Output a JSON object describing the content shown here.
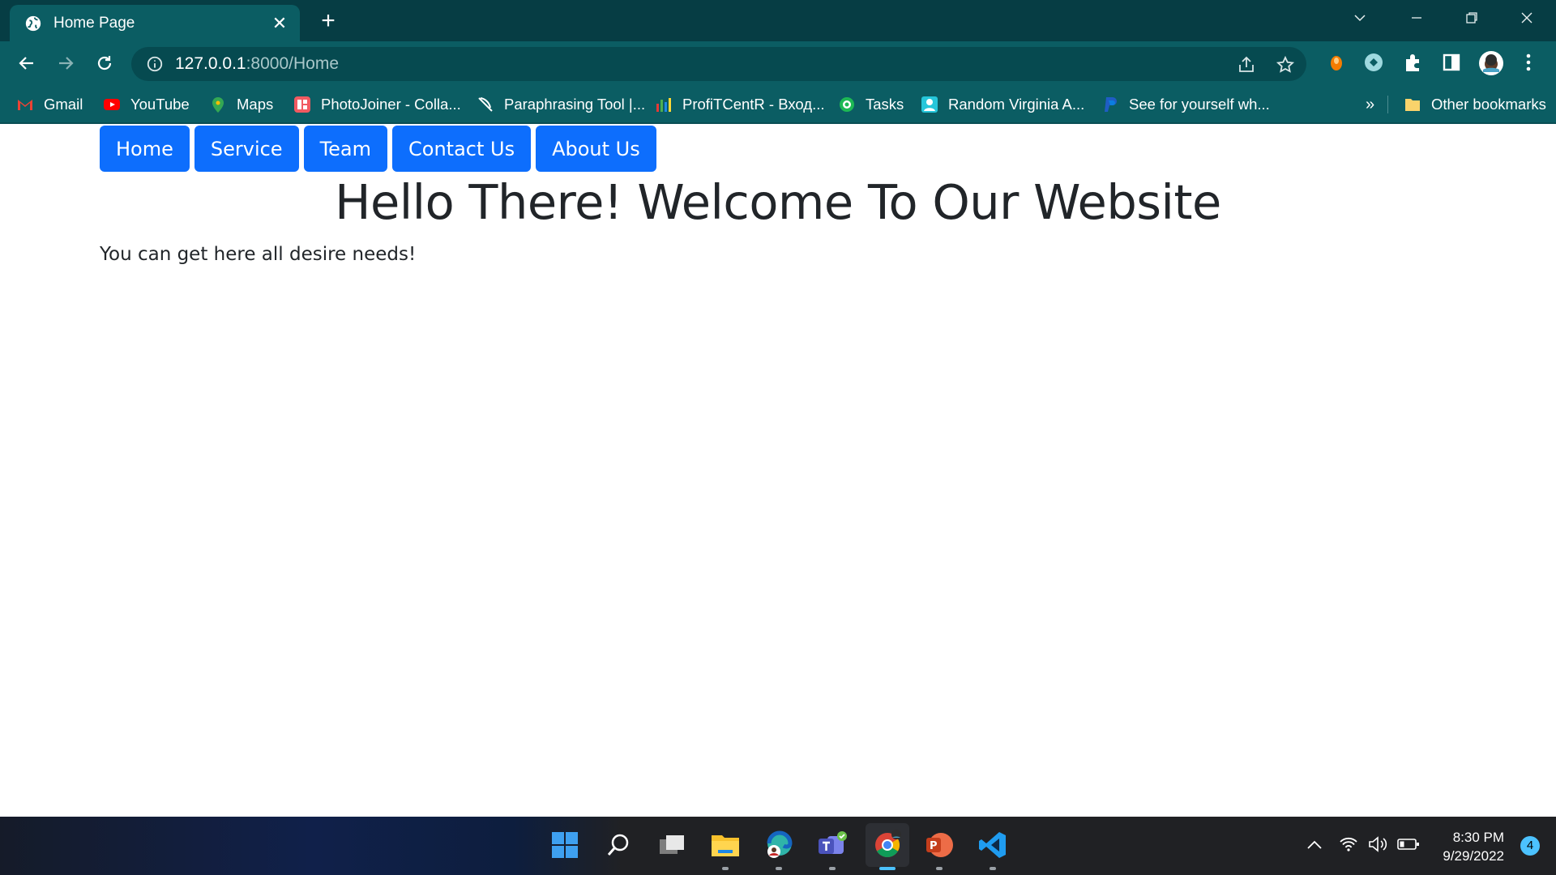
{
  "browser": {
    "tab": {
      "title": "Home Page",
      "icon": "globe-icon"
    },
    "url_host": "127.0.0.1",
    "url_rest": ":8000/Home",
    "bookmarks": [
      {
        "label": "Gmail",
        "icon": "gmail-icon",
        "color": "#ea4335"
      },
      {
        "label": "YouTube",
        "icon": "youtube-icon",
        "color": "#ff0000"
      },
      {
        "label": "Maps",
        "icon": "maps-icon",
        "color": "#34a853"
      },
      {
        "label": "PhotoJoiner - Colla...",
        "icon": "photojoiner-icon",
        "color": "#f15a61"
      },
      {
        "label": "Paraphrasing Tool |...",
        "icon": "feather-icon",
        "color": "#ffffff"
      },
      {
        "label": "ProfiTCentR - Вход...",
        "icon": "chart-icon",
        "color": "#4caf50"
      },
      {
        "label": "Tasks",
        "icon": "tasks-icon",
        "color": "#1db954"
      },
      {
        "label": "Random Virginia A...",
        "icon": "person-icon",
        "color": "#26c6da"
      },
      {
        "label": "See for yourself wh...",
        "icon": "paypal-icon",
        "color": "#1f5dc4"
      }
    ],
    "overflow_label": "»",
    "other_bookmarks": "Other bookmarks"
  },
  "page": {
    "nav": [
      "Home",
      "Service",
      "Team",
      "Contact Us",
      "About Us"
    ],
    "heading": "Hello There! Welcome To Our Website",
    "text": "You can get here all desire needs!"
  },
  "taskbar": {
    "time": "8:30 PM",
    "date": "9/29/2022",
    "notifications": "4"
  },
  "colors": {
    "accent": "#0d6efd",
    "chrome": "#0b5d63",
    "tabbar": "#063d44"
  }
}
